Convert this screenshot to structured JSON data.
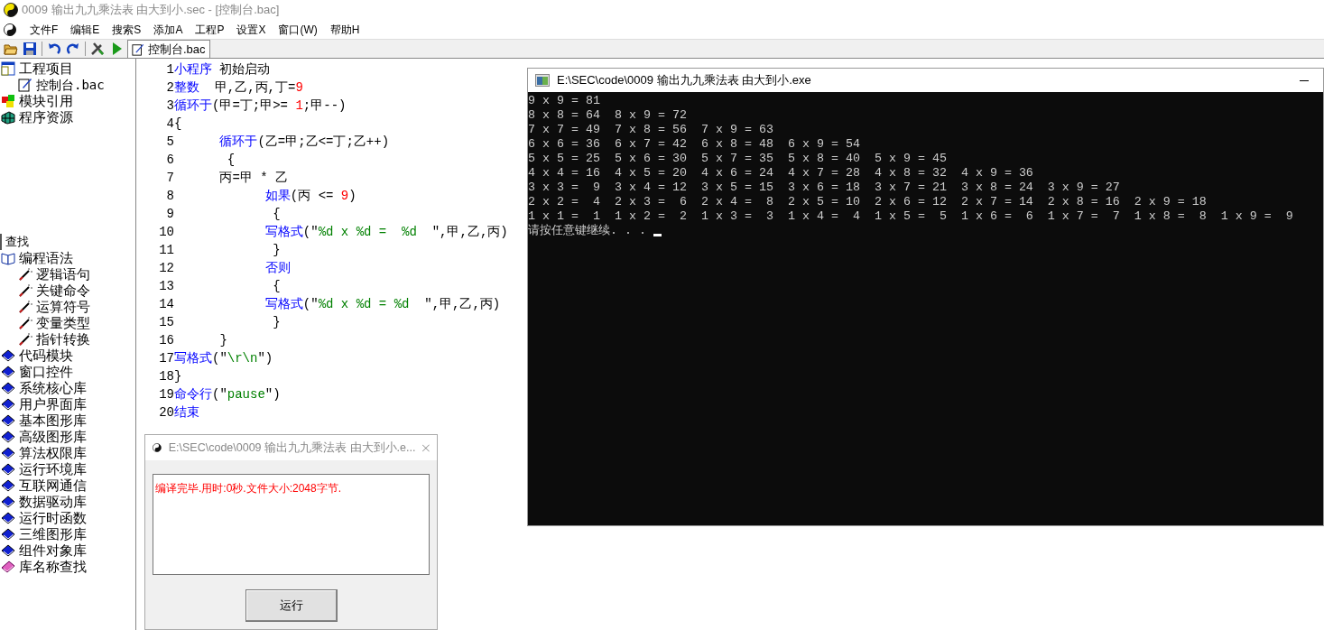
{
  "window": {
    "title": "0009 输出九九乘法表 由大到小.sec - [控制台.bac]"
  },
  "menu": [
    "文件F",
    "编辑E",
    "搜索S",
    "添加A",
    "工程P",
    "设置X",
    "窗口(W)",
    "帮助H"
  ],
  "toolbar": [
    {
      "kind": "open"
    },
    {
      "kind": "save"
    },
    {
      "kind": "undo"
    },
    {
      "kind": "redo"
    },
    {
      "kind": "build"
    },
    {
      "kind": "run"
    }
  ],
  "tabs": [
    {
      "label": "控制台.bac",
      "selected": true
    }
  ],
  "project_tree": [
    {
      "label": "工程项目",
      "kind": "project",
      "children": [
        {
          "label": "控制台.bac",
          "kind": "file"
        }
      ]
    },
    {
      "label": "模块引用",
      "kind": "module"
    },
    {
      "label": "程序资源",
      "kind": "resource"
    }
  ],
  "search_label": "查找",
  "library_tree": [
    {
      "label": "编程语法",
      "kind": "open-book",
      "children": [
        {
          "label": "逻辑语句",
          "kind": "wand"
        },
        {
          "label": "关键命令",
          "kind": "wand"
        },
        {
          "label": "运算符号",
          "kind": "wand"
        },
        {
          "label": "变量类型",
          "kind": "wand"
        },
        {
          "label": "指针转换",
          "kind": "wand"
        }
      ]
    },
    {
      "label": "代码模块",
      "kind": "book"
    },
    {
      "label": "窗口控件",
      "kind": "book"
    },
    {
      "label": "系统核心库",
      "kind": "book"
    },
    {
      "label": "用户界面库",
      "kind": "book"
    },
    {
      "label": "基本图形库",
      "kind": "book"
    },
    {
      "label": "高级图形库",
      "kind": "book"
    },
    {
      "label": "算法权限库",
      "kind": "book"
    },
    {
      "label": "运行环境库",
      "kind": "book"
    },
    {
      "label": "互联网通信",
      "kind": "book"
    },
    {
      "label": "数据驱动库",
      "kind": "book"
    },
    {
      "label": "运行时函数",
      "kind": "book"
    },
    {
      "label": "三维图形库",
      "kind": "book"
    },
    {
      "label": "组件对象库",
      "kind": "book"
    },
    {
      "label": "库名称查找",
      "kind": "search-book"
    }
  ],
  "code_lines": [
    {
      "number": "1",
      "tokens": [
        {
          "kind": "keyword",
          "text": "小程序"
        },
        {
          "kind": "plain",
          "text": " 初始启动"
        }
      ]
    },
    {
      "number": "2",
      "tokens": [
        {
          "kind": "keyword",
          "text": "整数"
        },
        {
          "kind": "plain",
          "text": "  甲,乙,丙,丁="
        },
        {
          "kind": "number",
          "text": "9"
        }
      ]
    },
    {
      "number": "3",
      "tokens": [
        {
          "kind": "keyword",
          "text": "循环于"
        },
        {
          "kind": "plain",
          "text": "(甲=丁;甲>= "
        },
        {
          "kind": "number",
          "text": "1"
        },
        {
          "kind": "plain",
          "text": ";甲--)"
        }
      ]
    },
    {
      "number": "4",
      "tokens": [
        {
          "kind": "plain",
          "text": "{"
        }
      ]
    },
    {
      "number": "5",
      "tokens": [
        {
          "kind": "keyword",
          "text": "      循环于"
        },
        {
          "kind": "plain",
          "text": "(乙=甲;乙<=丁;乙++)"
        }
      ]
    },
    {
      "number": "6",
      "tokens": [
        {
          "kind": "plain",
          "text": "       {"
        }
      ]
    },
    {
      "number": "7",
      "tokens": [
        {
          "kind": "plain",
          "text": "      丙=甲 * 乙"
        }
      ]
    },
    {
      "number": "8",
      "tokens": [
        {
          "kind": "keyword",
          "text": "            如果"
        },
        {
          "kind": "plain",
          "text": "(丙 <= "
        },
        {
          "kind": "number",
          "text": "9"
        },
        {
          "kind": "plain",
          "text": ")"
        }
      ]
    },
    {
      "number": "9",
      "tokens": [
        {
          "kind": "plain",
          "text": "             {"
        }
      ]
    },
    {
      "number": "10",
      "tokens": [
        {
          "kind": "keyword",
          "text": "            写格式"
        },
        {
          "kind": "plain",
          "text": "(\""
        },
        {
          "kind": "string",
          "text": "%d x %d =  %d  "
        },
        {
          "kind": "plain",
          "text": "\",甲,乙,丙)"
        }
      ]
    },
    {
      "number": "11",
      "tokens": [
        {
          "kind": "plain",
          "text": "             }"
        }
      ]
    },
    {
      "number": "12",
      "tokens": [
        {
          "kind": "keyword",
          "text": "            否则"
        }
      ]
    },
    {
      "number": "13",
      "tokens": [
        {
          "kind": "plain",
          "text": "             {"
        }
      ]
    },
    {
      "number": "14",
      "tokens": [
        {
          "kind": "keyword",
          "text": "            写格式"
        },
        {
          "kind": "plain",
          "text": "(\""
        },
        {
          "kind": "string",
          "text": "%d x %d = %d  "
        },
        {
          "kind": "plain",
          "text": "\",甲,乙,丙)"
        }
      ]
    },
    {
      "number": "15",
      "tokens": [
        {
          "kind": "plain",
          "text": "             }"
        }
      ]
    },
    {
      "number": "16",
      "tokens": [
        {
          "kind": "plain",
          "text": "      }"
        }
      ]
    },
    {
      "number": "17",
      "tokens": [
        {
          "kind": "keyword",
          "text": "写格式"
        },
        {
          "kind": "plain",
          "text": "(\""
        },
        {
          "kind": "string",
          "text": "\\r\\n"
        },
        {
          "kind": "plain",
          "text": "\")"
        }
      ]
    },
    {
      "number": "18",
      "tokens": [
        {
          "kind": "plain",
          "text": "}"
        }
      ]
    },
    {
      "number": "19",
      "tokens": [
        {
          "kind": "keyword",
          "text": "命令行"
        },
        {
          "kind": "plain",
          "text": "(\""
        },
        {
          "kind": "string",
          "text": "pause"
        },
        {
          "kind": "plain",
          "text": "\")"
        }
      ]
    },
    {
      "number": "20",
      "tokens": [
        {
          "kind": "keyword",
          "text": "结束"
        }
      ]
    }
  ],
  "console": {
    "title": "E:\\SEC\\code\\0009 输出九九乘法表 由大到小.exe",
    "lines": [
      "9 x 9 = 81",
      "8 x 8 = 64  8 x 9 = 72",
      "7 x 7 = 49  7 x 8 = 56  7 x 9 = 63",
      "6 x 6 = 36  6 x 7 = 42  6 x 8 = 48  6 x 9 = 54",
      "5 x 5 = 25  5 x 6 = 30  5 x 7 = 35  5 x 8 = 40  5 x 9 = 45",
      "4 x 4 = 16  4 x 5 = 20  4 x 6 = 24  4 x 7 = 28  4 x 8 = 32  4 x 9 = 36",
      "3 x 3 =  9  3 x 4 = 12  3 x 5 = 15  3 x 6 = 18  3 x 7 = 21  3 x 8 = 24  3 x 9 = 27",
      "2 x 2 =  4  2 x 3 =  6  2 x 4 =  8  2 x 5 = 10  2 x 6 = 12  2 x 7 = 14  2 x 8 = 16  2 x 9 = 18",
      "1 x 1 =  1  1 x 2 =  2  1 x 3 =  3  1 x 4 =  4  1 x 5 =  5  1 x 6 =  6  1 x 7 =  7  1 x 8 =  8  1 x 9 =  9"
    ],
    "prompt": "请按任意键继续. . . "
  },
  "dialog": {
    "title": "E:\\SEC\\code\\0009 输出九九乘法表 由大到小.e...",
    "message": "编译完毕.用时:0秒.文件大小:2048字节.",
    "button": "运行"
  }
}
